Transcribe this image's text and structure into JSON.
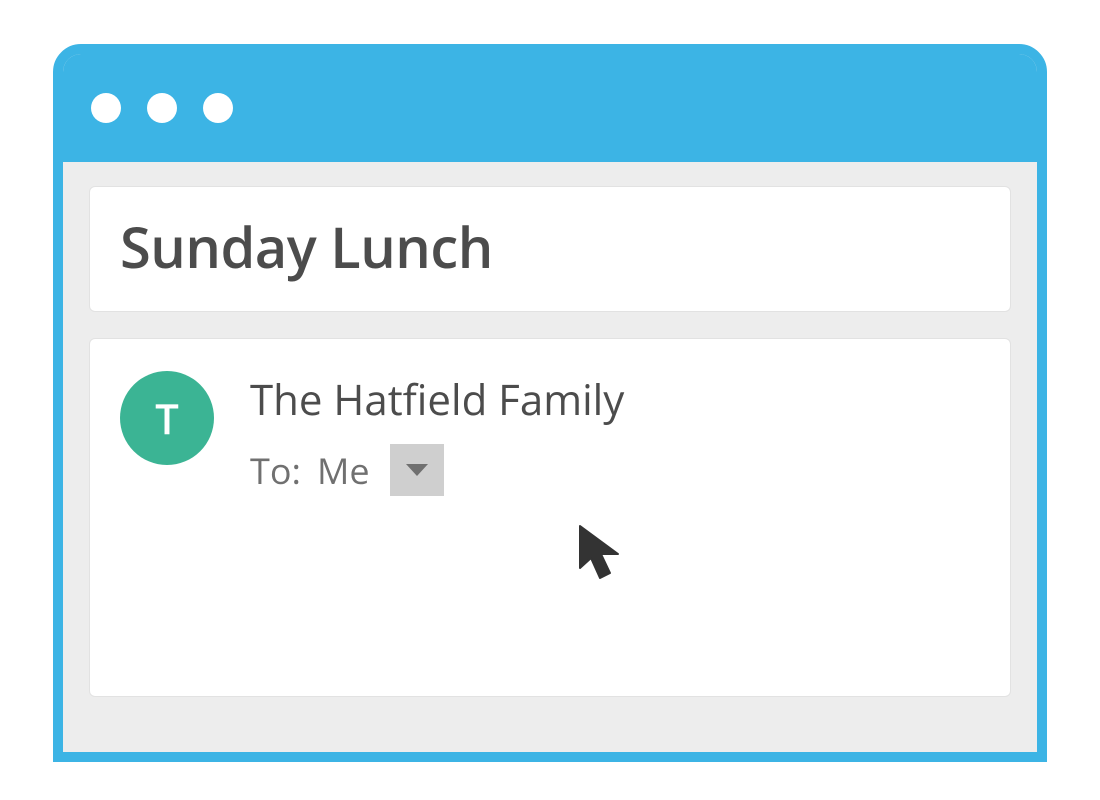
{
  "email": {
    "subject": "Sunday Lunch",
    "sender": {
      "name": "The Hatfield Family",
      "avatar_initial": "T"
    },
    "to": {
      "label": "To:",
      "value": "Me"
    }
  },
  "colors": {
    "titlebar": "#3cb4e5",
    "avatar": "#3bb494",
    "caret_bg": "#cfcfcf"
  },
  "icons": {
    "caret": "caret-down-icon",
    "cursor": "mouse-pointer-icon"
  }
}
